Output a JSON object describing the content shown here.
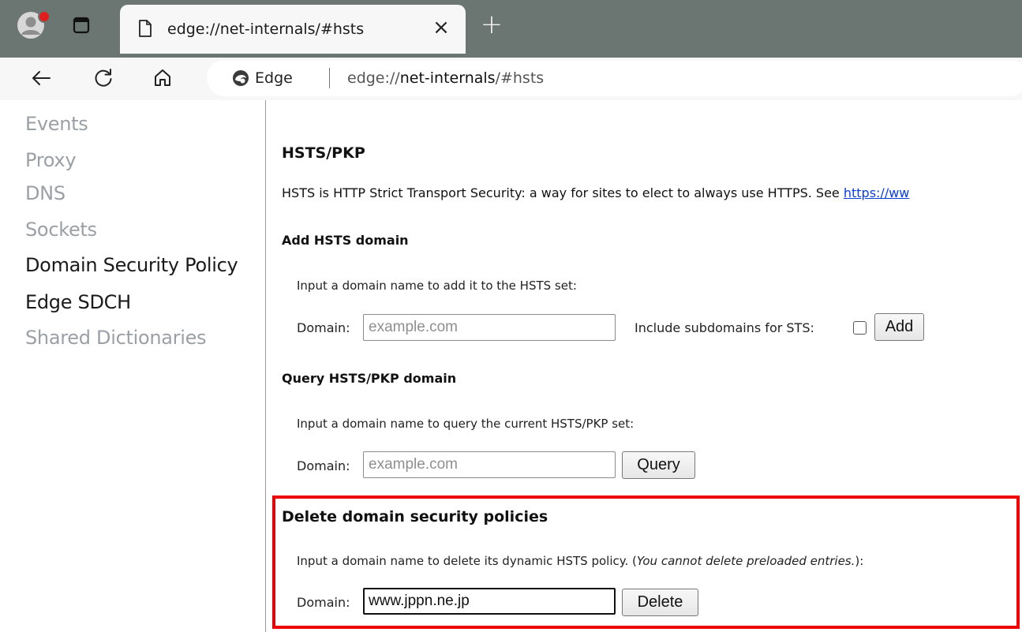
{
  "browser": {
    "tab": {
      "title": "edge://net-internals/#hsts",
      "close_glyph": "×"
    },
    "new_tab_glyph": "+",
    "address": {
      "site_chip": "Edge",
      "url_scheme": "edge://",
      "url_host": "net-internals",
      "url_path": "/#hsts"
    },
    "icons": {
      "profile": "profile-avatar-icon",
      "notification": "notification-dot-icon",
      "tab_actions": "tab-actions-icon",
      "page": "page-icon",
      "back": "back-arrow-icon",
      "refresh": "refresh-icon",
      "home": "home-icon",
      "edge": "edge-logo-icon"
    }
  },
  "sidebar": {
    "items": [
      {
        "label": "Events",
        "state": "dim"
      },
      {
        "label": "Proxy",
        "state": "dim"
      },
      {
        "label": "DNS",
        "state": "dim"
      },
      {
        "label": "Sockets",
        "state": "dim"
      },
      {
        "label": "Domain Security Policy",
        "state": "active"
      },
      {
        "label": "Edge SDCH",
        "state": "active"
      },
      {
        "label": "Shared Dictionaries",
        "state": "dim"
      }
    ]
  },
  "main": {
    "title": "HSTS/PKP",
    "intro_text": "HSTS is HTTP Strict Transport Security: a way for sites to elect to always use HTTPS. See ",
    "intro_link": "https://ww",
    "add": {
      "heading": "Add HSTS domain",
      "description": "Input a domain name to add it to the HSTS set:",
      "domain_label": "Domain:",
      "domain_placeholder": "example.com",
      "subdomains_label": "Include subdomains for STS:",
      "subdomains_checked": false,
      "button": "Add"
    },
    "query": {
      "heading": "Query HSTS/PKP domain",
      "description": "Input a domain name to query the current HSTS/PKP set:",
      "domain_label": "Domain:",
      "domain_placeholder": "example.com",
      "button": "Query"
    },
    "delete": {
      "heading": "Delete domain security policies",
      "description": "Input a domain name to delete its dynamic HSTS policy. (",
      "description_italic": "You cannot delete preloaded entries.",
      "description_end": "):",
      "domain_label": "Domain:",
      "domain_value": "www.jppn.ne.jp",
      "button": "Delete"
    }
  },
  "colors": {
    "tabstrip": "#6b7572",
    "toolbar": "#f7f7f7",
    "highlight_border": "#ee0000",
    "link": "#0b3fd6",
    "dim_text": "#9aa0a6"
  }
}
